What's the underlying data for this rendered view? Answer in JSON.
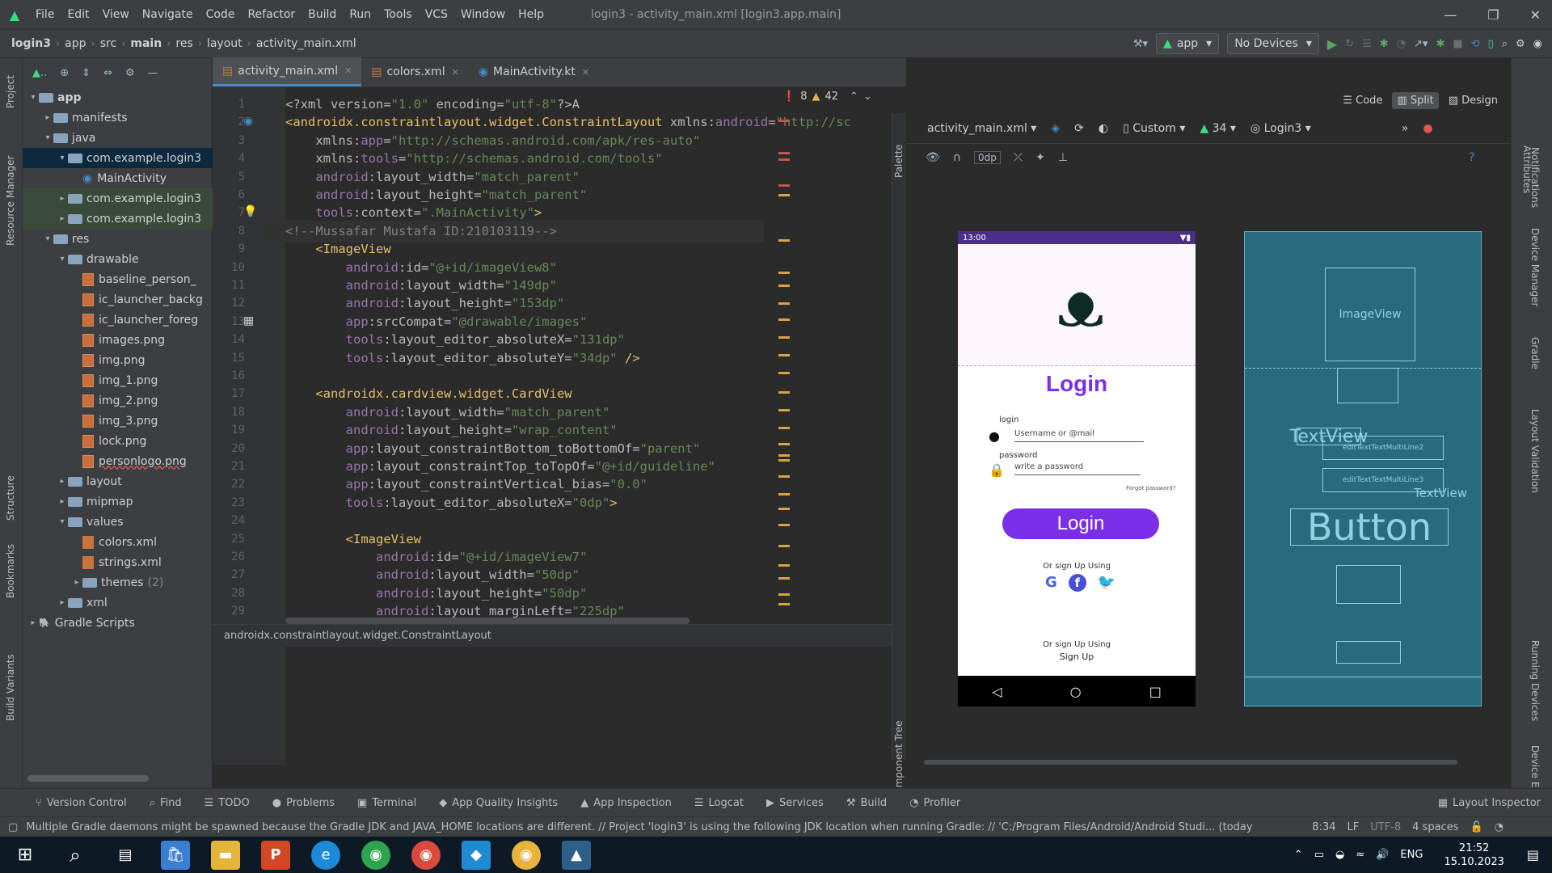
{
  "menu": {
    "items": [
      "File",
      "Edit",
      "View",
      "Navigate",
      "Code",
      "Refactor",
      "Build",
      "Run",
      "Tools",
      "VCS",
      "Window",
      "Help"
    ],
    "title": "login3 - activity_main.xml [login3.app.main]"
  },
  "nav": {
    "crumbs": [
      "login3",
      "app",
      "src",
      "main",
      "res",
      "layout",
      "activity_main.xml"
    ],
    "run_config": "app",
    "device": "No Devices"
  },
  "left_tools": {
    "project": "Project",
    "resource_manager": "Resource Manager",
    "structure": "Structure",
    "bookmarks": "Bookmarks",
    "build_variants": "Build Variants"
  },
  "tree": [
    {
      "label": "app",
      "depth": 0,
      "arrow": "▾",
      "type": "folder",
      "style": "bold"
    },
    {
      "label": "manifests",
      "depth": 1,
      "arrow": "▸",
      "type": "folder"
    },
    {
      "label": "java",
      "depth": 1,
      "arrow": "▾",
      "type": "folder"
    },
    {
      "label": "com.example.login3",
      "depth": 2,
      "arrow": "▾",
      "type": "folder",
      "style": "sel"
    },
    {
      "label": "MainActivity",
      "depth": 3,
      "arrow": "",
      "type": "kt"
    },
    {
      "label": "com.example.login3",
      "depth": 2,
      "arrow": "▸",
      "type": "folder",
      "style": "hl"
    },
    {
      "label": "com.example.login3",
      "depth": 2,
      "arrow": "▸",
      "type": "folder",
      "style": "hl"
    },
    {
      "label": "res",
      "depth": 1,
      "arrow": "▾",
      "type": "folder"
    },
    {
      "label": "drawable",
      "depth": 2,
      "arrow": "▾",
      "type": "folder"
    },
    {
      "label": "baseline_person_",
      "depth": 3,
      "arrow": "",
      "type": "img"
    },
    {
      "label": "ic_launcher_backg",
      "depth": 3,
      "arrow": "",
      "type": "img"
    },
    {
      "label": "ic_launcher_foreg",
      "depth": 3,
      "arrow": "",
      "type": "img"
    },
    {
      "label": "images.png",
      "depth": 3,
      "arrow": "",
      "type": "img"
    },
    {
      "label": "img.png",
      "depth": 3,
      "arrow": "",
      "type": "img"
    },
    {
      "label": "img_1.png",
      "depth": 3,
      "arrow": "",
      "type": "img"
    },
    {
      "label": "img_2.png",
      "depth": 3,
      "arrow": "",
      "type": "img"
    },
    {
      "label": "img_3.png",
      "depth": 3,
      "arrow": "",
      "type": "img"
    },
    {
      "label": "lock.png",
      "depth": 3,
      "arrow": "",
      "type": "img"
    },
    {
      "label": "personlogo.png",
      "depth": 3,
      "arrow": "",
      "type": "img",
      "style": "err"
    },
    {
      "label": "layout",
      "depth": 2,
      "arrow": "▸",
      "type": "folder"
    },
    {
      "label": "mipmap",
      "depth": 2,
      "arrow": "▸",
      "type": "folder"
    },
    {
      "label": "values",
      "depth": 2,
      "arrow": "▾",
      "type": "folder"
    },
    {
      "label": "colors.xml",
      "depth": 3,
      "arrow": "",
      "type": "xml"
    },
    {
      "label": "strings.xml",
      "depth": 3,
      "arrow": "",
      "type": "xml"
    },
    {
      "label": "themes",
      "depth": 3,
      "arrow": "▸",
      "type": "folder",
      "suffix": "(2)"
    },
    {
      "label": "xml",
      "depth": 2,
      "arrow": "▸",
      "type": "folder"
    },
    {
      "label": "Gradle Scripts",
      "depth": 0,
      "arrow": "▸",
      "type": "gradle"
    }
  ],
  "tabs": [
    {
      "label": "activity_main.xml",
      "active": true
    },
    {
      "label": "colors.xml"
    },
    {
      "label": "MainActivity.kt"
    }
  ],
  "view_modes": {
    "code": "Code",
    "split": "Split",
    "design": "Design"
  },
  "inspections": {
    "errors": "8",
    "warnings": "42"
  },
  "code": [
    {
      "n": "1",
      "parts": [
        [
          "at",
          "<?xml version="
        ],
        [
          "av",
          "\"1.0\""
        ],
        [
          "at",
          " encoding="
        ],
        [
          "av",
          "\"utf-8\""
        ],
        [
          "at",
          "?>"
        ],
        [
          "at",
          "A"
        ]
      ]
    },
    {
      "n": "2",
      "parts": [
        [
          "tag",
          "<androidx.constraintlayout.widget.ConstraintLayout"
        ],
        [
          "at",
          " xmlns:"
        ],
        [
          "an",
          "android"
        ],
        [
          "at",
          "="
        ],
        [
          "av",
          "\"http://sc"
        ]
      ]
    },
    {
      "n": "3",
      "parts": [
        [
          "at",
          "    xmlns:"
        ],
        [
          "an",
          "app"
        ],
        [
          "at",
          "="
        ],
        [
          "av",
          "\"http://schemas.android.com/apk/res-auto\""
        ]
      ]
    },
    {
      "n": "4",
      "parts": [
        [
          "at",
          "    xmlns:"
        ],
        [
          "an",
          "tools"
        ],
        [
          "at",
          "="
        ],
        [
          "av",
          "\"http://schemas.android.com/tools\""
        ]
      ]
    },
    {
      "n": "5",
      "parts": [
        [
          "an",
          "    android"
        ],
        [
          "at",
          ":layout_width="
        ],
        [
          "av",
          "\"match_parent\""
        ]
      ]
    },
    {
      "n": "6",
      "parts": [
        [
          "an",
          "    android"
        ],
        [
          "at",
          ":layout_height="
        ],
        [
          "av",
          "\"match_parent\""
        ]
      ]
    },
    {
      "n": "7",
      "parts": [
        [
          "an",
          "    tools"
        ],
        [
          "at",
          ":context="
        ],
        [
          "av",
          "\".MainActivity\""
        ],
        [
          "tag",
          ">"
        ]
      ]
    },
    {
      "n": "8",
      "parts": [
        [
          "cm",
          "<!--Mussafar Mustafa ID:210103119-->"
        ]
      ]
    },
    {
      "n": "9",
      "parts": [
        [
          "tag",
          "    <ImageView"
        ]
      ]
    },
    {
      "n": "10",
      "parts": [
        [
          "an",
          "        android"
        ],
        [
          "at",
          ":id="
        ],
        [
          "av",
          "\"@+id/imageView8\""
        ]
      ]
    },
    {
      "n": "11",
      "parts": [
        [
          "an",
          "        android"
        ],
        [
          "at",
          ":layout_width="
        ],
        [
          "av",
          "\"149dp\""
        ]
      ]
    },
    {
      "n": "12",
      "parts": [
        [
          "an",
          "        android"
        ],
        [
          "at",
          ":layout_height="
        ],
        [
          "av",
          "\"153dp\""
        ]
      ]
    },
    {
      "n": "13",
      "parts": [
        [
          "an",
          "        app"
        ],
        [
          "at",
          ":srcCompat="
        ],
        [
          "av",
          "\"@drawable/images\""
        ]
      ]
    },
    {
      "n": "14",
      "parts": [
        [
          "an",
          "        tools"
        ],
        [
          "at",
          ":layout_editor_absoluteX="
        ],
        [
          "av",
          "\"131dp\""
        ]
      ]
    },
    {
      "n": "15",
      "parts": [
        [
          "an",
          "        tools"
        ],
        [
          "at",
          ":layout_editor_absoluteY="
        ],
        [
          "av",
          "\"34dp\""
        ],
        [
          "tag",
          " />"
        ]
      ]
    },
    {
      "n": "16",
      "parts": []
    },
    {
      "n": "17",
      "parts": [
        [
          "tag",
          "    <androidx.cardview.widget.CardView"
        ]
      ]
    },
    {
      "n": "18",
      "parts": [
        [
          "an",
          "        android"
        ],
        [
          "at",
          ":layout_width="
        ],
        [
          "av",
          "\"match_parent\""
        ]
      ]
    },
    {
      "n": "19",
      "parts": [
        [
          "an",
          "        android"
        ],
        [
          "at",
          ":layout_height="
        ],
        [
          "av",
          "\"wrap_content\""
        ]
      ]
    },
    {
      "n": "20",
      "parts": [
        [
          "an",
          "        app"
        ],
        [
          "at",
          ":layout_constraintBottom_toBottomOf="
        ],
        [
          "av",
          "\"parent\""
        ]
      ]
    },
    {
      "n": "21",
      "parts": [
        [
          "an",
          "        app"
        ],
        [
          "at",
          ":layout_constraintTop_toTopOf="
        ],
        [
          "av",
          "\"@+id/guideline\""
        ]
      ]
    },
    {
      "n": "22",
      "parts": [
        [
          "an",
          "        app"
        ],
        [
          "at",
          ":layout_constraintVertical_bias="
        ],
        [
          "av",
          "\"0.0\""
        ]
      ]
    },
    {
      "n": "23",
      "parts": [
        [
          "an",
          "        tools"
        ],
        [
          "at",
          ":layout_editor_absoluteX="
        ],
        [
          "av",
          "\"0dp\""
        ],
        [
          "tag",
          ">"
        ]
      ]
    },
    {
      "n": "24",
      "parts": []
    },
    {
      "n": "25",
      "parts": [
        [
          "tag",
          "        <ImageView"
        ]
      ]
    },
    {
      "n": "26",
      "parts": [
        [
          "an",
          "            android"
        ],
        [
          "at",
          ":id="
        ],
        [
          "av",
          "\"@+id/imageView7\""
        ]
      ]
    },
    {
      "n": "27",
      "parts": [
        [
          "an",
          "            android"
        ],
        [
          "at",
          ":layout_width="
        ],
        [
          "av",
          "\"50dp\""
        ]
      ]
    },
    {
      "n": "28",
      "parts": [
        [
          "an",
          "            android"
        ],
        [
          "at",
          ":layout_height="
        ],
        [
          "av",
          "\"50dp\""
        ]
      ]
    },
    {
      "n": "29",
      "parts": [
        [
          "an",
          "            android"
        ],
        [
          "at",
          ":layout_marginLeft="
        ],
        [
          "av",
          "\"225dp\""
        ]
      ]
    }
  ],
  "editor_breadcrumb": "androidx.constraintlayout.widget.ConstraintLayout",
  "design_toolbar": {
    "file": "activity_main.xml",
    "device": "Custom",
    "api": "34",
    "theme": "Login3",
    "dp": "0dp"
  },
  "palette_label": "Palette",
  "component_tree_label": "Component Tree",
  "right_tools": {
    "notifications": "Notifications",
    "attributes": "Attributes",
    "device_manager": "Device Manager",
    "gradle": "Gradle",
    "layout_validation": "Layout Validation",
    "running_devices": "Running Devices",
    "device_explorer": "Device Explorer"
  },
  "phone": {
    "time": "13:00",
    "title": "Login",
    "login_label": "login",
    "username_hint": "Username or @mail",
    "password_label": "password",
    "password_hint": "write a password",
    "forgot": "Forgot password?",
    "button": "Login",
    "or_sign": "Or sign Up Using",
    "or_sign2": "Or sign Up Using",
    "signup": "Sign Up"
  },
  "blueprint": {
    "imageview": "ImageView",
    "textview": "TextView",
    "textview2": "TextView",
    "button": "Button",
    "edit1": "editTextTextMultiLine2",
    "edit2": "editTextTextMultiLine3"
  },
  "bottom_tools": [
    "Version Control",
    "Find",
    "TODO",
    "Problems",
    "Terminal",
    "App Quality Insights",
    "App Inspection",
    "Logcat",
    "Services",
    "Build",
    "Profiler"
  ],
  "layout_inspector": "Layout Inspector",
  "status": {
    "message": "Multiple Gradle daemons might be spawned because the Gradle JDK and JAVA_HOME locations are different. // Project 'login3' is using the following JDK location when running Gradle: // 'C:/Program Files/Android/Android Studi... (today",
    "pos": "8:34",
    "lf": "LF",
    "enc": "UTF-8",
    "indent": "4 spaces"
  },
  "taskbar": {
    "lang": "ENG",
    "time": "21:52",
    "date": "15.10.2023"
  },
  "colors": {
    "accent": "#4a88c7",
    "purple": "#7a2fe6",
    "bg": "#2b2b2b"
  }
}
